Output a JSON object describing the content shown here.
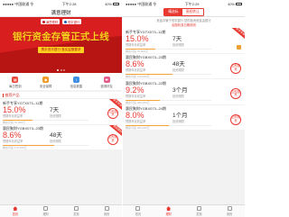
{
  "left": {
    "status": {
      "carrier": "●●●●● 中国联通 令",
      "time": "下午2:28",
      "battery": "40%"
    },
    "title": "满意理财",
    "banner": {
      "logo_left": "满意理财",
      "logo_right": "恒丰银行",
      "headline": "银行资金存管正式上线",
      "subline": "携手恒丰银行 落实监管要求"
    },
    "quick_menu": [
      {
        "label": "每日签到",
        "icon": "calendar-icon"
      },
      {
        "label": "安全保障",
        "icon": "shield-icon"
      },
      {
        "label": "信息披露",
        "icon": "info-icon"
      },
      {
        "label": "邀请好友",
        "icon": "gift-icon"
      }
    ],
    "section_title": "推荐产品",
    "products": [
      {
        "name": "新手专享YGTX073--11期",
        "rate": "15.0%",
        "rate_label": "预期年化收益率",
        "term": "7天",
        "term_label": "投资期限",
        "progress": 0.35,
        "footer": "剩余可投 70,000元",
        "ribbon": "新手专享",
        "badge": "立即投资"
      },
      {
        "name": "惠民聚财YGBX073--23期",
        "rate": "8.6%",
        "rate_label": "预期年化收益率",
        "term": "48天",
        "term_label": "投资期限",
        "progress": 0.6,
        "footer": "剩余可投 170,000元",
        "ribbon": "惠民聚财",
        "badge": "立即投资"
      }
    ],
    "tabs": [
      {
        "label": "首页",
        "active": true
      },
      {
        "label": "理财",
        "active": false
      },
      {
        "label": "发现",
        "active": false
      },
      {
        "label": "我的",
        "active": false
      }
    ]
  },
  "right": {
    "status": {
      "carrier": "●●●●● 中国联通 令",
      "time": "下午2:29",
      "battery": "40%"
    },
    "segments": [
      {
        "label": "精选标",
        "active": true
      },
      {
        "label": "债权转让",
        "active": false
      }
    ],
    "notice_line1": "资金存管于恒丰银行 您的投资资金由银行",
    "notice_line2": "起投利息日期说明",
    "products": [
      {
        "name": "新手专享YGTX073--11期",
        "rate": "15.0%",
        "rate_label": "预期年化收益率",
        "term": "7天",
        "term_label": "投资期限",
        "progress": 0.35,
        "footer": "剩余可投 70,000元",
        "ribbon": "新手专享",
        "badge": "立即投资"
      },
      {
        "name": "惠民聚财YGBX073--23期",
        "rate": "8.6%",
        "rate_label": "预期年化收益率",
        "term": "48天",
        "term_label": "投资期限",
        "progress": 0.55,
        "footer": "剩余可投 170,000元",
        "ribbon": "惠民聚财",
        "badge": "立即投资"
      },
      {
        "name": "惠民聚财YGBX073--22期",
        "rate": "9.2%",
        "rate_label": "预期年化收益率",
        "term": "3个月",
        "term_label": "投资期限",
        "progress": 0.4,
        "footer": "剩余可投 300,000元",
        "ribbon": "惠民聚财",
        "badge": "立即投资"
      },
      {
        "name": "惠民聚财YGBX073--24期",
        "rate": "8.0%",
        "rate_label": "预期年化收益率",
        "term": "1个月",
        "term_label": "投资期限",
        "progress": 0.5,
        "footer": "剩余可投 200,000元",
        "ribbon": "惠民聚财",
        "badge": "立即投资"
      }
    ],
    "tabs": [
      {
        "label": "首页",
        "active": false
      },
      {
        "label": "理财",
        "active": true
      },
      {
        "label": "发现",
        "active": false
      },
      {
        "label": "我的",
        "active": false
      }
    ]
  },
  "colors": {
    "accent": "#e8382f",
    "banner_red": "#d81e1e",
    "banner_gold": "#ffd21f"
  }
}
